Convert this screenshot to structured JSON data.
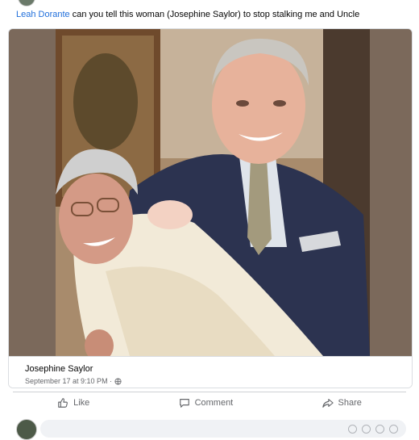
{
  "post": {
    "mention": "Leah Dorante",
    "caption_text": " can you tell this woman (Josephine Saylor) to stop stalking me and Uncle"
  },
  "shared": {
    "name": "Josephine Saylor",
    "date": "September 17 at 9:10 PM ·"
  },
  "actions": {
    "like": "Like",
    "comment": "Comment",
    "share": "Share"
  },
  "colors": {
    "link": "#216fdb",
    "muted": "#65676b",
    "divider": "#ced0d4"
  }
}
